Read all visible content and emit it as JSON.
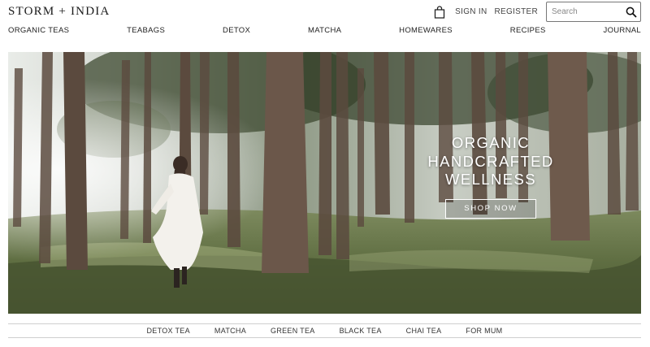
{
  "header": {
    "logo_text": "STORM + INDIA",
    "cart_icon": "shopping-bag-icon",
    "sign_in": "SIGN IN",
    "register": "REGISTER",
    "search": {
      "placeholder": "Search",
      "icon": "search-icon"
    }
  },
  "nav": {
    "items": [
      "ORGANIC TEAS",
      "TEABAGS",
      "DETOX",
      "MATCHA",
      "HOMEWARES",
      "RECIPES",
      "JOURNAL"
    ]
  },
  "hero": {
    "headline": [
      "ORGANIC",
      "HANDCRAFTED",
      "WELLNESS"
    ],
    "cta": "SHOP NOW"
  },
  "subnav": {
    "items": [
      "DETOX TEA",
      "MATCHA",
      "GREEN TEA",
      "BLACK TEA",
      "CHAI TEA",
      "FOR MUM"
    ]
  },
  "colors": {
    "text": "#222222",
    "border": "#cfcfcf",
    "cta_text": "#ffffff"
  }
}
